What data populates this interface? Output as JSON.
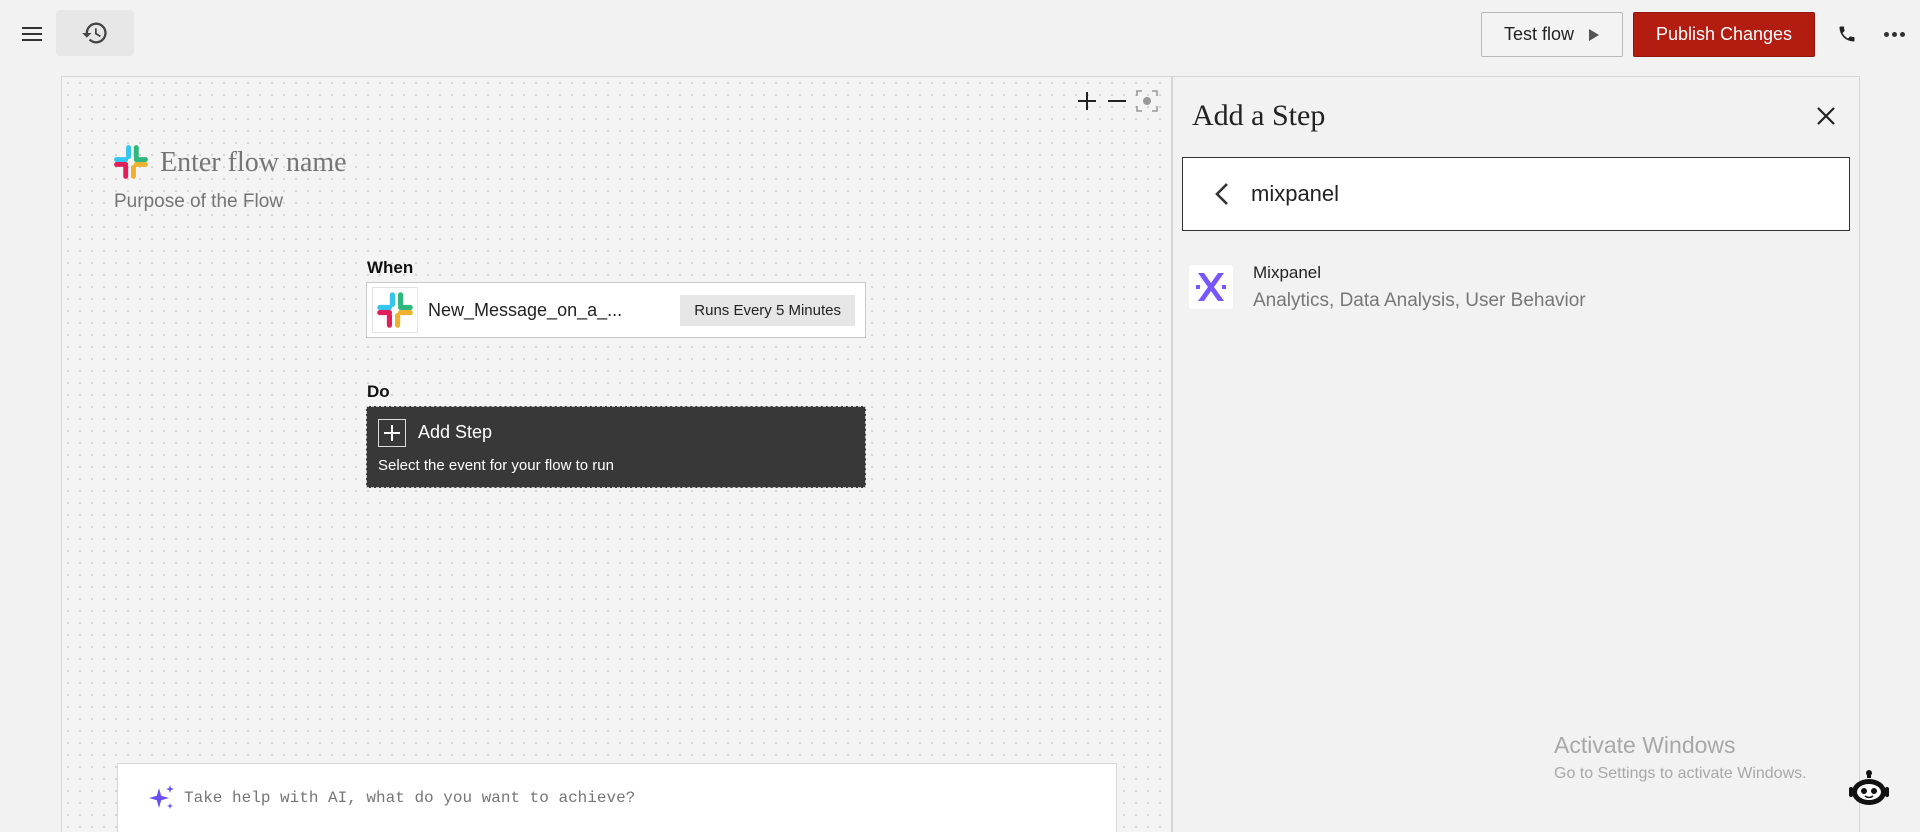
{
  "header": {
    "menu_icon": "hamburger-menu-icon",
    "history_icon": "history-icon",
    "test_flow_label": "Test flow",
    "publish_label": "Publish Changes",
    "phone_icon": "phone-icon",
    "more_icon": "more-horizontal-icon",
    "colors": {
      "publish_bg": "#b31c10"
    }
  },
  "canvas": {
    "flow_name_placeholder": "Enter flow name",
    "flow_purpose_placeholder": "Purpose of the Flow",
    "when_label": "When",
    "trigger": {
      "name": "New_Message_on_a_...",
      "schedule": "Runs Every 5 Minutes",
      "app_icon": "slack-icon"
    },
    "do_label": "Do",
    "add_step": {
      "title": "Add Step",
      "subtitle": "Select the event for your flow to run"
    },
    "ai_placeholder": "Take help with AI, what do you want to achieve?"
  },
  "panel": {
    "title": "Add a Step",
    "search_value": "mixpanel",
    "results": [
      {
        "name": "Mixpanel",
        "tags": "Analytics, Data Analysis, User Behavior",
        "icon": "mixpanel-icon"
      }
    ]
  },
  "watermark": {
    "title": "Activate Windows",
    "subtitle": "Go to Settings to activate Windows."
  }
}
